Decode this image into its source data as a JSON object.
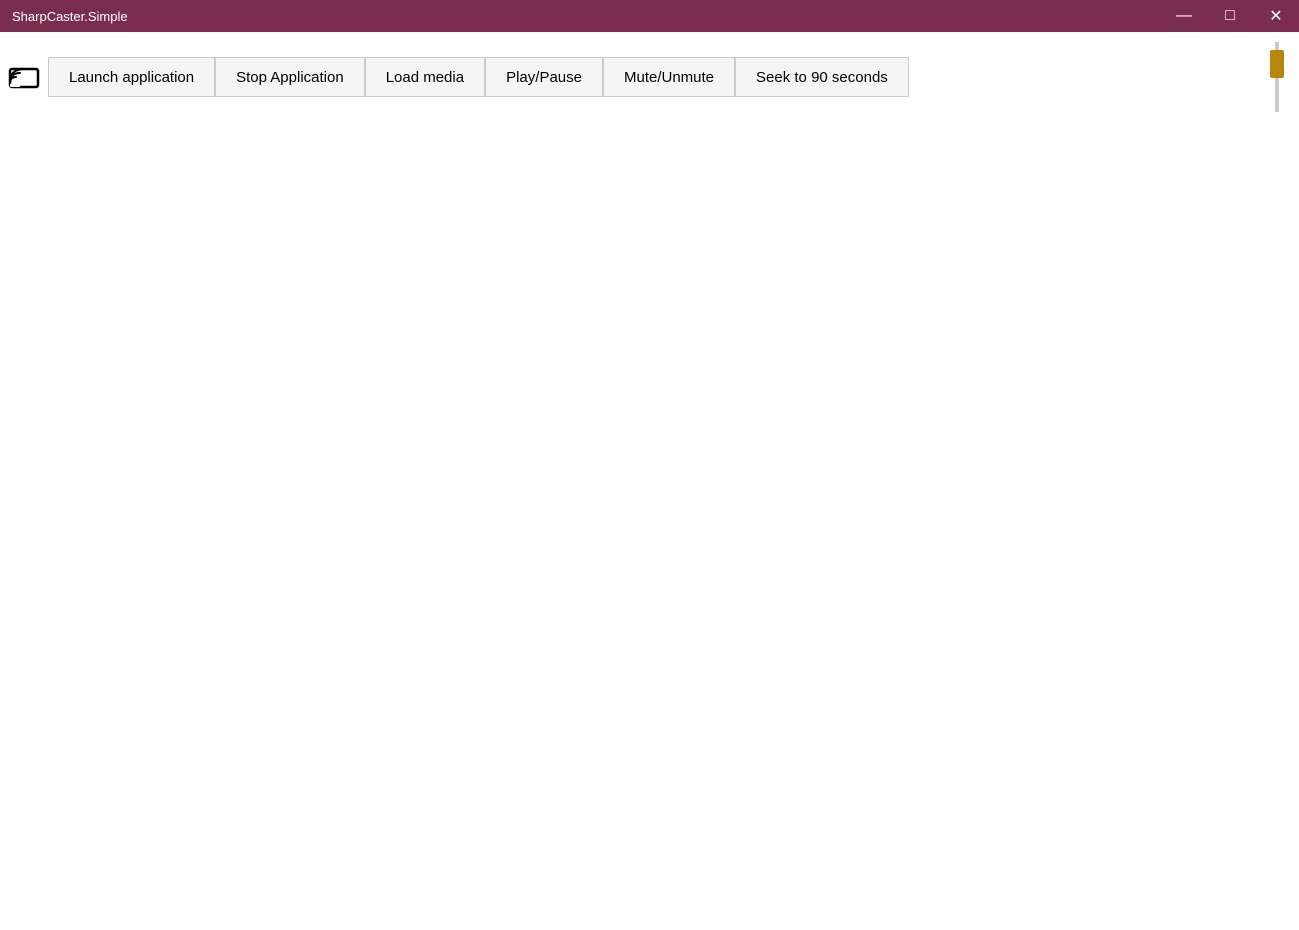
{
  "titleBar": {
    "title": "SharpCaster.Simple",
    "minimizeLabel": "—",
    "maximizeLabel": "□",
    "closeLabel": "✕"
  },
  "toolbar": {
    "buttons": [
      {
        "id": "launch-application",
        "label": "Launch application"
      },
      {
        "id": "stop-application",
        "label": "Stop Application"
      },
      {
        "id": "load-media",
        "label": "Load media"
      },
      {
        "id": "play-pause",
        "label": "Play/Pause"
      },
      {
        "id": "mute-unmute",
        "label": "Mute/Unmute"
      },
      {
        "id": "seek-90",
        "label": "Seek to 90 seconds"
      }
    ],
    "sliderValue": 80,
    "sliderMin": 0,
    "sliderMax": 100
  },
  "castIcon": {
    "name": "cast-icon",
    "unicode": "📡"
  }
}
